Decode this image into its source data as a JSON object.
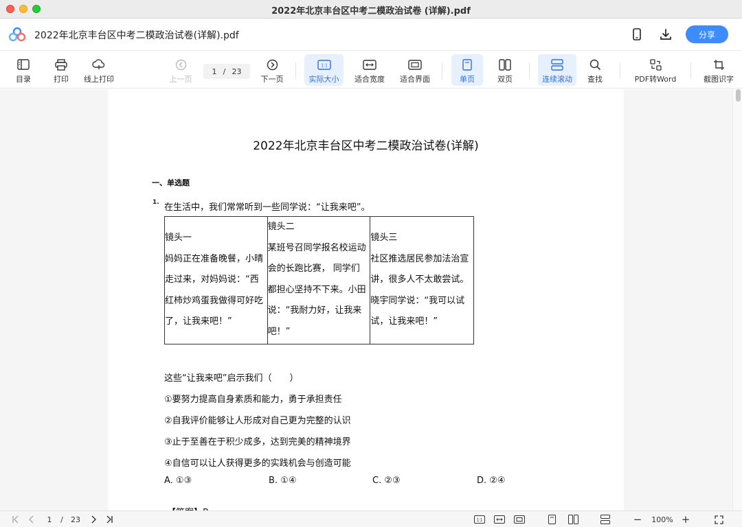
{
  "window": {
    "title": "2022年北京丰台区中考二模政治试卷 (详解).pdf"
  },
  "header": {
    "doc_title": "2022年北京丰台区中考二模政治试卷(详解).pdf",
    "share_label": "分享"
  },
  "toolbar": {
    "toc": "目录",
    "print": "打印",
    "online_print": "线上打印",
    "prev_page": "上一页",
    "current_page": "1",
    "page_sep": "/",
    "total_pages": "23",
    "next_page": "下一页",
    "actual_size": "实际大小",
    "fit_width": "适合宽度",
    "fit_page": "适合界面",
    "single_page": "单页",
    "double_page": "双页",
    "continuous": "连续滚动",
    "find": "查找",
    "pdf_to_word": "PDF转Word",
    "ocr": "截图识字",
    "actual_size_icon_text": "1:1"
  },
  "document": {
    "heading": "2022年北京丰台区中考二模政治试卷(详解)",
    "section": "一、单选题",
    "question_number": "1.",
    "question_text": "在生活中，我们常常听到一些同学说：“让我来吧”。",
    "table": [
      {
        "lines": [
          "镜头一",
          "妈妈正在准备晚餐，小晴",
          "走过来，对妈妈说：“西",
          "红柿炒鸡蛋我做得可好吃",
          "了，让我来吧！”"
        ]
      },
      {
        "lines": [
          "镜头二",
          "某班号召同学报名校运动",
          "会的长跑比赛， 同学们",
          "都担心坚持不下来。小田",
          "说：“我耐力好，让我来",
          "吧！”"
        ]
      },
      {
        "lines": [
          "镜头三",
          "社区推选居民参加法治宣",
          "讲，很多人不太敢尝试。",
          "晓宇同学说：“我可以试",
          "试，让我来吧！”"
        ]
      }
    ],
    "prompt": "这些“让我来吧”启示我们（　　）",
    "statements": [
      "①要努力提高自身素质和能力，勇于承担责任",
      "②自我评价能够让人形成对自己更为完整的认识",
      "③止于至善在于积少成多，达到完美的精神境界",
      "④自信可以让人获得更多的实践机会与创造可能"
    ],
    "options": [
      "A. ①③",
      "B. ①④",
      "C. ②③",
      "D. ②④"
    ],
    "answer": "【答案】B"
  },
  "statusbar": {
    "current_page": "1",
    "page_sep": "/",
    "total_pages": "23",
    "zoom": "100%",
    "zoom_out": "−",
    "zoom_in": "+"
  }
}
